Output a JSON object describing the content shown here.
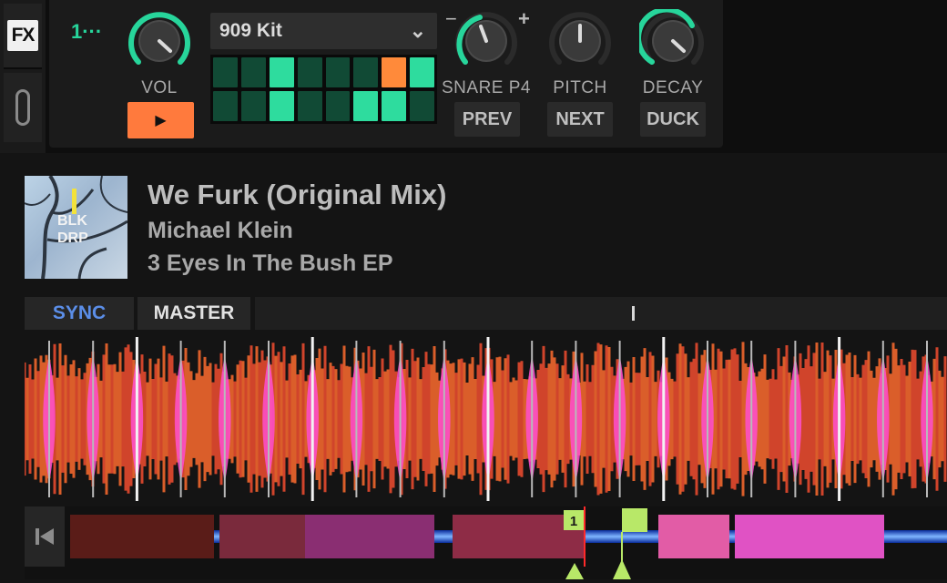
{
  "sidebar": {
    "fx_label": "FX",
    "fx_icon": "fx-icon",
    "link_icon": "link-icon"
  },
  "fx_unit": {
    "slot_label": "1···",
    "volume": {
      "label": "VOL",
      "level": 0.65
    },
    "play_glyph": "▶",
    "kit": {
      "label": "909 Kit",
      "chevron": "⌄"
    },
    "pattern": {
      "rows": [
        [
          "off",
          "off",
          "on",
          "off",
          "off",
          "off",
          "cur",
          "on"
        ],
        [
          "off",
          "off",
          "on",
          "off",
          "off",
          "on",
          "on",
          "off"
        ]
      ]
    },
    "snare": {
      "label": "SNARE P4",
      "minus": "−",
      "plus": "+",
      "level": 0.42
    },
    "pitch": {
      "label": "PITCH",
      "level": 0.5
    },
    "decay": {
      "label": "DECAY",
      "level": 0.72
    },
    "buttons": {
      "prev": "PREV",
      "next": "NEXT",
      "duck": "DUCK"
    }
  },
  "deck": {
    "cover": {
      "text_line1": "BLK",
      "text_line2": "DRP"
    },
    "title": "We Furk (Original Mix)",
    "artist": "Michael Klein",
    "album": "3 Eyes In The Bush EP",
    "sync_label": "SYNC",
    "master_label": "MASTER",
    "overview": {
      "cue_number": "1",
      "playhead_fraction": 0.585
    }
  },
  "colors": {
    "accent_green": "#27d59b",
    "play_orange": "#ff7a3d",
    "sync_blue": "#5b8ee8",
    "cue_green": "#b8e868"
  }
}
